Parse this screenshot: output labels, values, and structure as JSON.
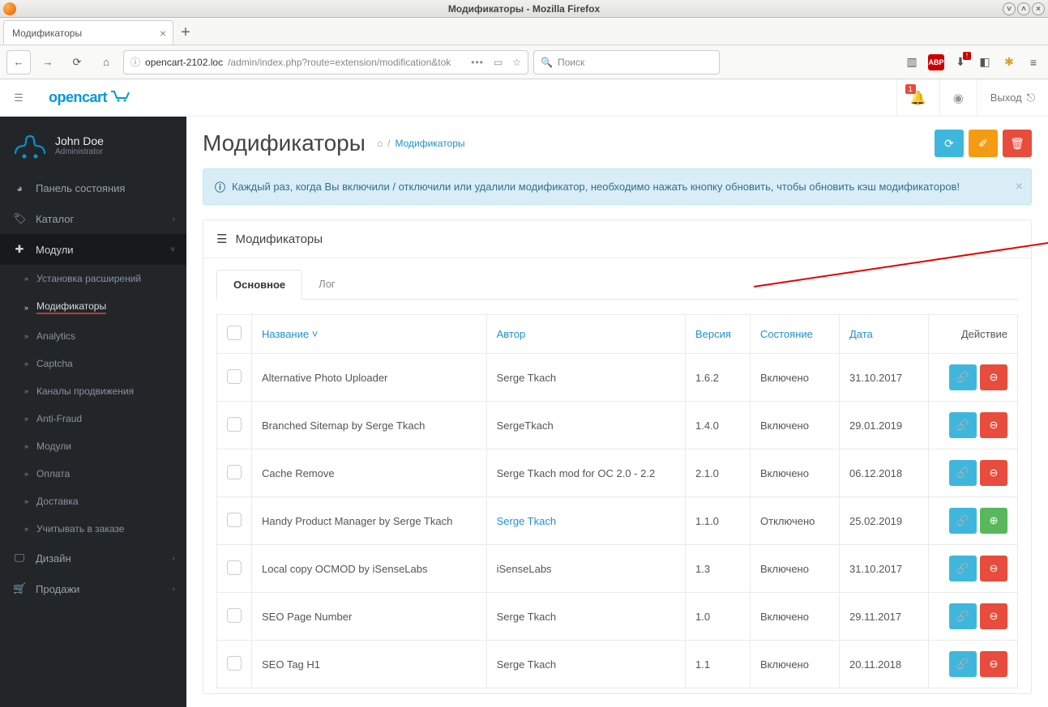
{
  "window": {
    "title": "Модификаторы - Mozilla Firefox"
  },
  "browser": {
    "tab_title": "Модификаторы",
    "url_host": "opencart-2102.loc",
    "url_path": "/admin/index.php?route=extension/modification&tok",
    "search_placeholder": "Поиск"
  },
  "header": {
    "logo": "opencart",
    "notifications": "1",
    "logout": "Выход"
  },
  "profile": {
    "name": "John Doe",
    "role": "Administrator"
  },
  "sidebar": {
    "dashboard": "Панель состояния",
    "catalog": "Каталог",
    "modules": "Модули",
    "sub": {
      "install": "Установка расширений",
      "modifications": "Модификаторы",
      "analytics": "Analytics",
      "captcha": "Captcha",
      "feeds": "Каналы продвижения",
      "antifraud": "Anti-Fraud",
      "mods": "Модули",
      "payments": "Оплата",
      "shipping": "Доставка",
      "totals": "Учитывать в заказе"
    },
    "design": "Дизайн",
    "sales": "Продажи"
  },
  "content": {
    "title": "Модификаторы",
    "breadcrumb": "Модификаторы",
    "alert": "Каждый раз, когда Вы включили / отключили или удалили модификатор, необходимо нажать кнопку обновить, чтобы обновить кэш модификаторов!",
    "panel_title": "Модификаторы",
    "tabs": {
      "main": "Основное",
      "log": "Лог"
    },
    "columns": {
      "name": "Название",
      "author": "Автор",
      "version": "Версия",
      "status": "Состояние",
      "date": "Дата",
      "action": "Действие"
    },
    "rows": [
      {
        "name": "Alternative Photo Uploader",
        "author": "Serge Tkach",
        "author_link": false,
        "version": "1.6.2",
        "status": "Включено",
        "date": "31.10.2017",
        "enabled": true
      },
      {
        "name": "Branched Sitemap by Serge Tkach",
        "author": "SergeTkach",
        "author_link": false,
        "version": "1.4.0",
        "status": "Включено",
        "date": "29.01.2019",
        "enabled": true
      },
      {
        "name": "Cache Remove",
        "author": "Serge Tkach mod for OC 2.0 - 2.2",
        "author_link": false,
        "version": "2.1.0",
        "status": "Включено",
        "date": "06.12.2018",
        "enabled": true
      },
      {
        "name": "Handy Product Manager by Serge Tkach",
        "author": "Serge Tkach",
        "author_link": true,
        "version": "1.1.0",
        "status": "Отключено",
        "date": "25.02.2019",
        "enabled": false
      },
      {
        "name": "Local copy OCMOD by iSenseLabs",
        "author": "iSenseLabs",
        "author_link": false,
        "version": "1.3",
        "status": "Включено",
        "date": "31.10.2017",
        "enabled": true
      },
      {
        "name": "SEO Page Number",
        "author": "Serge Tkach",
        "author_link": false,
        "version": "1.0",
        "status": "Включено",
        "date": "29.11.2017",
        "enabled": true
      },
      {
        "name": "SEO Tag H1",
        "author": "Serge Tkach",
        "author_link": false,
        "version": "1.1",
        "status": "Включено",
        "date": "20.11.2018",
        "enabled": true
      }
    ]
  }
}
